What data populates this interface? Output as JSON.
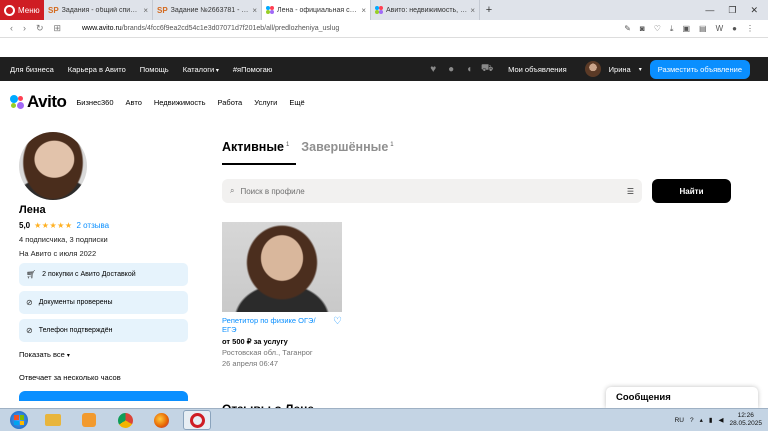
{
  "browser": {
    "menu_label": "Меню",
    "tabs": [
      {
        "title": "Задания - общий список",
        "favicon": "sp",
        "active": false
      },
      {
        "title": "Задание №2663781 - про",
        "favicon": "sp",
        "active": false
      },
      {
        "title": "Лена - официальная стра",
        "favicon": "avito",
        "active": true
      },
      {
        "title": "Авито: недвижимость, тра",
        "favicon": "avito",
        "active": false
      }
    ],
    "new_tab": "+",
    "url_domain": "www.avito.ru",
    "url_path": "/brands/4fcc6f9ea2cd54c1e3d07071d7f201eb/all/predlozheniya_uslug"
  },
  "topbar": {
    "links": [
      "Для бизнеса",
      "Карьера в Авито",
      "Помощь",
      "Каталоги",
      "#яПомогаю"
    ],
    "my_ads": "Мои объявления",
    "user_name": "Ирина",
    "post_button": "Разместить объявление"
  },
  "logo": {
    "text": "Avito"
  },
  "categories": [
    "Бизнес360",
    "Авто",
    "Недвижимость",
    "Работа",
    "Услуги",
    "Ещё"
  ],
  "profile": {
    "name": "Лена",
    "rating": "5,0",
    "stars": "★★★★★",
    "reviews": "2 отзыва",
    "subscribers": "4 подписчика, 3 подписки",
    "since": "На Авито с июля 2022",
    "badges": [
      {
        "icon": "cart-icon",
        "text": "2 покупки с Авито Доставкой"
      },
      {
        "icon": "check-circle-icon",
        "text": "Документы проверены"
      },
      {
        "icon": "check-circle-icon",
        "text": "Телефон подтверждён"
      }
    ],
    "show_all": "Показать все",
    "replies": "Отвечает за несколько часов"
  },
  "tabs": {
    "active": {
      "label": "Активные",
      "count": "1"
    },
    "completed": {
      "label": "Завершённые",
      "count": "1"
    }
  },
  "search": {
    "placeholder": "Поиск в профиле",
    "button": "Найти"
  },
  "listing": {
    "title": "Репетитор по физике ОГЭ/ЕГЭ",
    "price": "от 500 ₽ за услугу",
    "location": "Ростовская обл., Таганрог",
    "date": "26 апреля 06:47"
  },
  "reviews_title": "Отзывы о Лене",
  "messages_popup": "Сообщения",
  "taskbar": {
    "lang": "RU",
    "time": "12:26",
    "date": "28.05.2025"
  },
  "colors": {
    "accent": "#0a8fff",
    "dark_bar": "#1f1f1f",
    "badge_bg": "#e6f3fc",
    "opera_red": "#cf1d24",
    "star": "#ffb021"
  }
}
